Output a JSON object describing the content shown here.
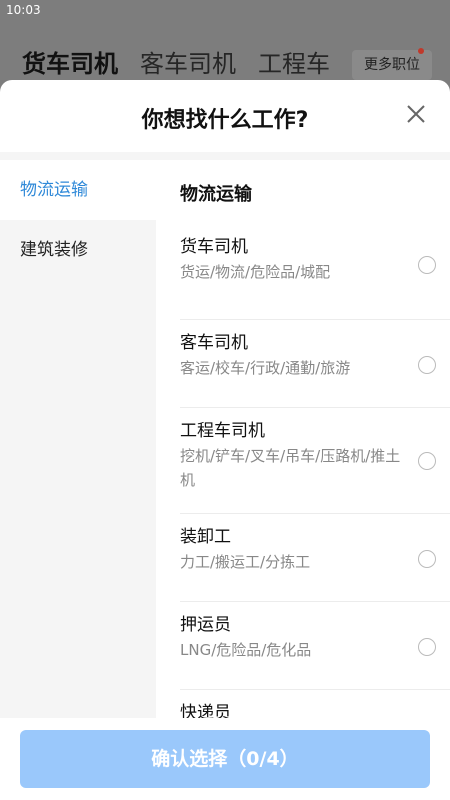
{
  "status_bar": {
    "time": "10:03"
  },
  "background_tabs": {
    "items": [
      "货车司机",
      "客车司机",
      "工程车"
    ],
    "more_label": "更多职位"
  },
  "sheet": {
    "title": "你想找什么工作?"
  },
  "sidebar": {
    "items": [
      {
        "label": "物流运输",
        "active": true
      },
      {
        "label": "建筑装修",
        "active": false
      }
    ]
  },
  "content": {
    "section_title": "物流运输",
    "jobs": [
      {
        "name": "货车司机",
        "desc": "货运/物流/危险品/城配"
      },
      {
        "name": "客车司机",
        "desc": "客运/校车/行政/通勤/旅游"
      },
      {
        "name": "工程车司机",
        "desc": "挖机/铲车/叉车/吊车/压路机/推土机"
      },
      {
        "name": "装卸工",
        "desc": "力工/搬运工/分拣工"
      },
      {
        "name": "押运员",
        "desc": "LNG/危险品/危化品"
      },
      {
        "name": "快递员",
        "desc": ""
      }
    ]
  },
  "footer": {
    "confirm_label": "确认选择（0/4）"
  },
  "colors": {
    "accent": "#2f89d8",
    "button_disabled": "#9ac8fb",
    "overlay": "#7d7d7d",
    "sidebar_bg": "#f5f5f5"
  }
}
